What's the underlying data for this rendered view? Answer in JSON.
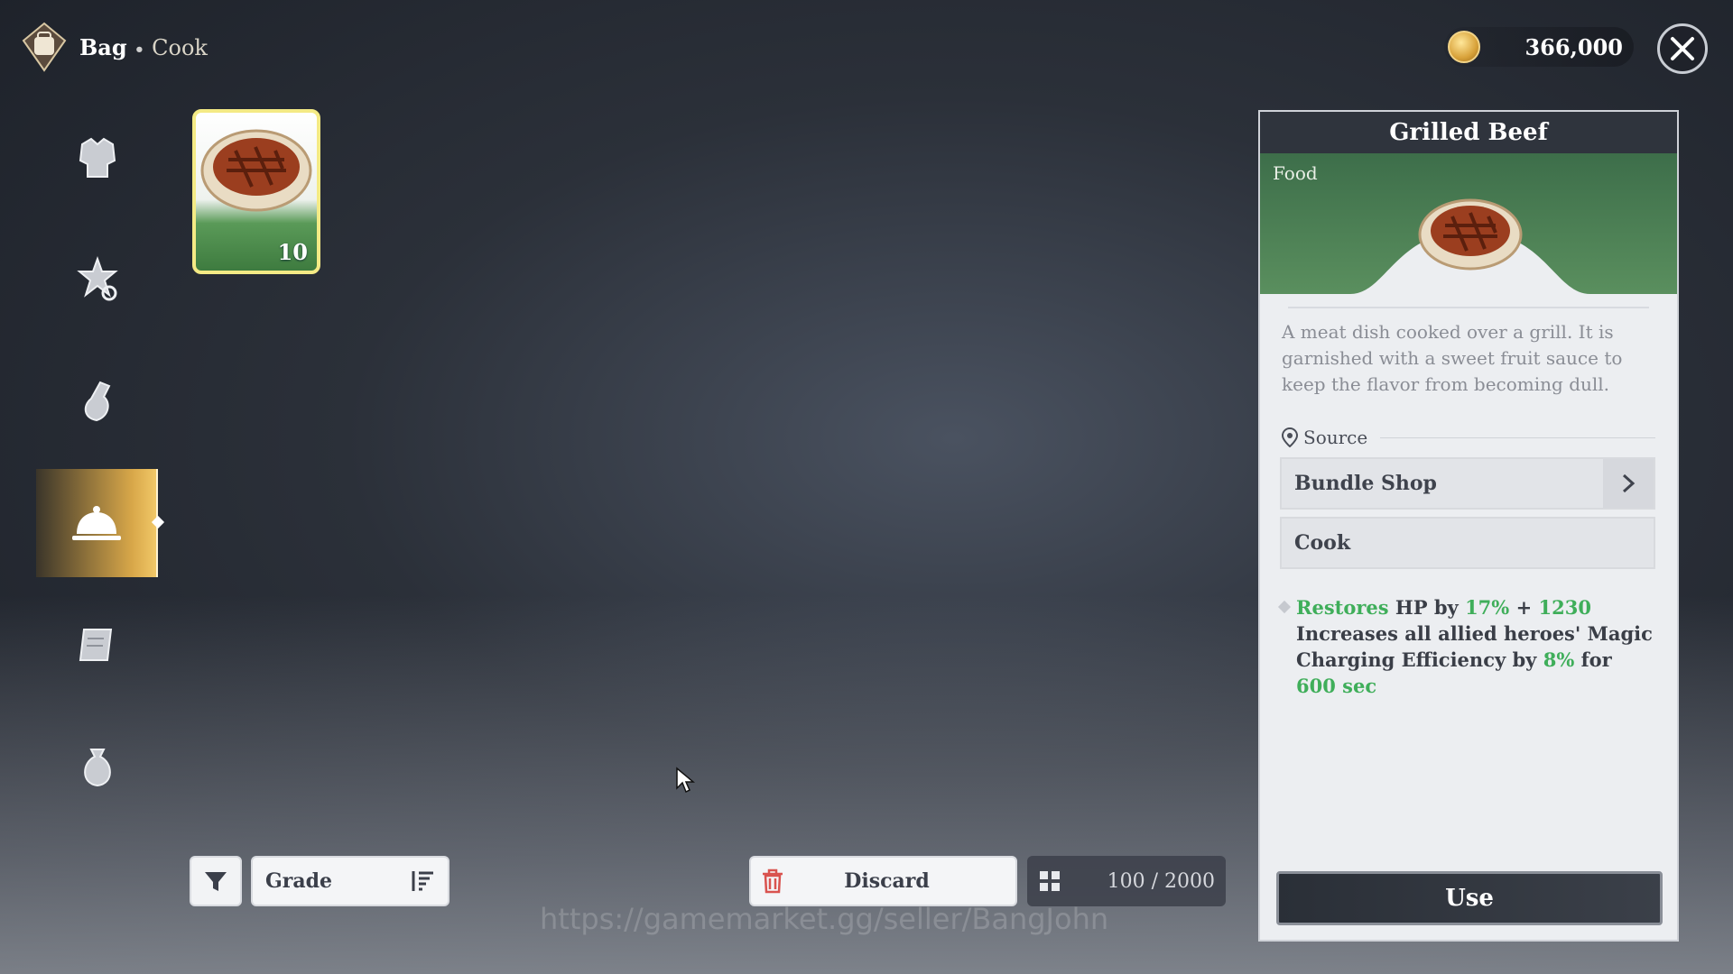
{
  "header": {
    "title": "Bag",
    "separator": "•",
    "subtitle": "Cook"
  },
  "currency": {
    "amount": "366,000",
    "icon": "gold-coin-icon"
  },
  "sidebar": {
    "items": [
      {
        "icon": "armor-icon",
        "active": false
      },
      {
        "icon": "gear-star-icon",
        "active": false
      },
      {
        "icon": "potion-icon",
        "active": false
      },
      {
        "icon": "cloche-icon",
        "active": true
      },
      {
        "icon": "scroll-icon",
        "active": false
      },
      {
        "icon": "pouch-icon",
        "active": false
      }
    ]
  },
  "inventory": {
    "items": [
      {
        "name": "Grilled Beef",
        "count": "10",
        "icon": "grilled-beef-icon"
      }
    ]
  },
  "bottombar": {
    "grade_label": "Grade",
    "discard_label": "Discard",
    "capacity": "100 / 2000"
  },
  "watermark": "https://gamemarket.gg/seller/BangJohn",
  "detail": {
    "title": "Grilled Beef",
    "type": "Food",
    "description": "A meat dish cooked over a grill. It is garnished with a sweet fruit sauce to keep the flavor from becoming dull.",
    "source_label": "Source",
    "sources": [
      "Bundle Shop",
      "Cook"
    ],
    "effect": {
      "restores": "Restores",
      "hp_by": "HP by",
      "pct": "17%",
      "plus": "+",
      "flat": "1230",
      "line2": "Increases all allied heroes' Magic Charging Efficiency by",
      "pct2": "8%",
      "for": "for",
      "duration": "600 sec"
    },
    "use_label": "Use"
  },
  "colors": {
    "accent_gold": "#d8a749",
    "effect_green": "#3fae5a",
    "card_border": "#f4ea85"
  }
}
